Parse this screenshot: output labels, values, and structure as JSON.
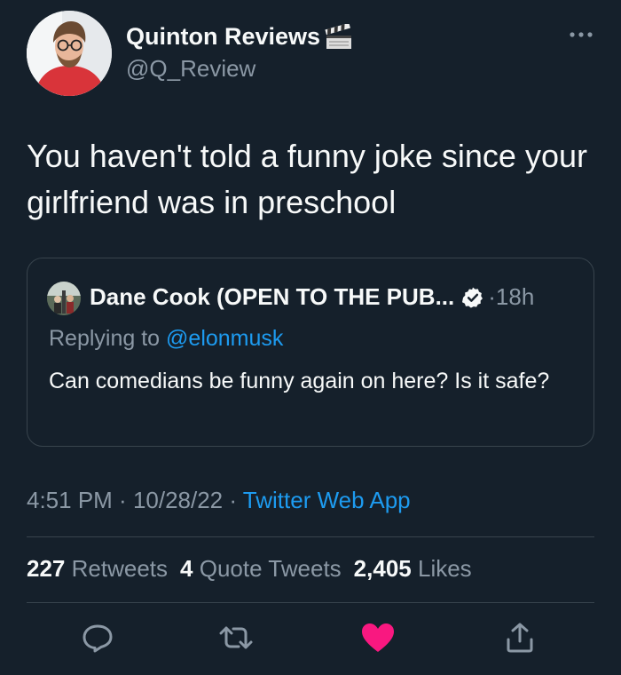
{
  "author": {
    "display_name": "Quinton Reviews",
    "handle": "@Q_Review"
  },
  "tweet": {
    "text": "You haven't told a funny joke since your girlfriend was in preschool"
  },
  "quoted_tweet": {
    "display_name": "Dane Cook (OPEN TO THE PUB...",
    "time": "·18h",
    "replying_prefix": "Replying to ",
    "replying_to": "@elonmusk",
    "text": "Can comedians be funny again on here? Is it safe?"
  },
  "meta": {
    "time": "4:51 PM",
    "sep1": " · ",
    "date": "10/28/22",
    "sep2": " · ",
    "source": "Twitter Web App"
  },
  "stats": {
    "retweets_count": "227",
    "retweets_label": "Retweets",
    "quotes_count": "4",
    "quotes_label": "Quote Tweets",
    "likes_count": "2,405",
    "likes_label": "Likes"
  },
  "colors": {
    "background": "#15202b",
    "accent": "#1d9bf0",
    "like": "#f91880",
    "muted": "#8b98a5",
    "border": "#38444d"
  },
  "icons": [
    "clapperboard-icon",
    "more-icon",
    "verified-badge-icon",
    "reply-icon",
    "retweet-icon",
    "like-icon",
    "share-icon"
  ]
}
